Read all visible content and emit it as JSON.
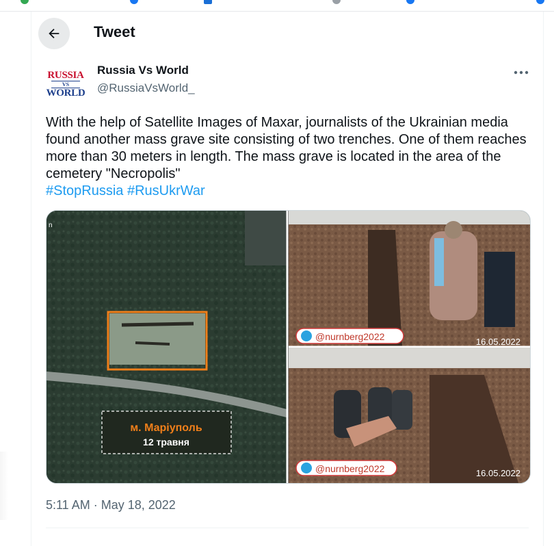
{
  "header": {
    "title": "Tweet"
  },
  "author": {
    "name": "Russia Vs World",
    "handle": "@RussiaVsWorld_",
    "avatar": {
      "line1": "RUSSIA",
      "line2": "VS",
      "line3": "WORLD"
    }
  },
  "tweet": {
    "text": "With the help of Satellite Images of Maxar, journalists of the Ukrainian media found another mass grave site consisting of two trenches. One of them reaches more than 30 meters in length. The mass grave is located in the area of the cemetery \"Necropolis\"",
    "hashtags": [
      "#StopRussia",
      "#RusUkrWar"
    ],
    "timestamp": "5:11 AM · May 18, 2022"
  },
  "media": {
    "satellite": {
      "city": "м. Маріуполь",
      "date": "12 травня",
      "corner_mark": "n"
    },
    "photo_top": {
      "watermark": "@nurnberg2022",
      "date": "16.05.2022"
    },
    "photo_bottom": {
      "watermark": "@nurnberg2022",
      "date": "16.05.2022"
    }
  },
  "colors": {
    "accent": "#1d9bf0",
    "text": "#0f1419",
    "muted": "#536471",
    "highlight_box": "#f07f1a"
  }
}
